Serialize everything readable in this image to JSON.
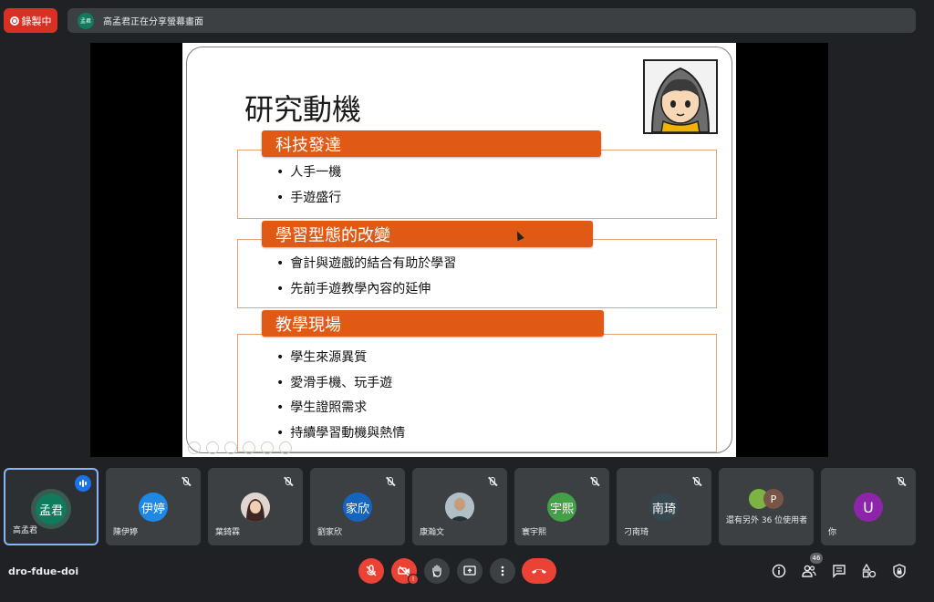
{
  "top_bar": {
    "recording_label": "錄製中",
    "presenter_initials": "孟君",
    "sharing_text": "高孟君正在分享螢幕畫面"
  },
  "slide": {
    "title": "研究動機",
    "sections": [
      {
        "header": "科技發達",
        "bullets": [
          "人手一機",
          "手遊盛行"
        ]
      },
      {
        "header": "學習型態的改變",
        "bullets": [
          "會計與遊戲的結合有助於學習",
          "先前手遊教學內容的延伸"
        ]
      },
      {
        "header": "教學現場",
        "bullets": [
          "學生來源異質",
          "愛滑手機、玩手遊",
          "學生證照需求",
          "持續學習動機與熱情"
        ]
      }
    ]
  },
  "participants": [
    {
      "name": "高孟君",
      "avatar_text": "孟君",
      "color": "#0f7a5d",
      "speaking": true
    },
    {
      "name": "陳伊婷",
      "avatar_text": "伊婷",
      "color": "#1e88e5",
      "muted": true
    },
    {
      "name": "葉錡霖",
      "avatar_text": "",
      "color": "#8d6e63",
      "muted": true,
      "photo": true
    },
    {
      "name": "劉家欣",
      "avatar_text": "家欣",
      "color": "#1565c0",
      "muted": true
    },
    {
      "name": "康瀚文",
      "avatar_text": "",
      "color": "#5d4037",
      "muted": true,
      "photo": true
    },
    {
      "name": "寰宇熙",
      "avatar_text": "宇熙",
      "color": "#43a047",
      "muted": true
    },
    {
      "name": "刁南琦",
      "avatar_text": "南琦",
      "color": "#37474f",
      "muted": true
    },
    {
      "name": "還有另外 36 位使用者",
      "avatar_text": "P",
      "color": "#795548",
      "group": true
    },
    {
      "name": "你",
      "avatar_text": "U",
      "color": "#8e24aa",
      "muted": true
    }
  ],
  "bottom_bar": {
    "meeting_code": "dro-fdue-doi",
    "participant_count": "46"
  },
  "colors": {
    "accent_red": "#ea4335",
    "section_orange": "#e05a16",
    "active_border": "#8ab4f8"
  }
}
